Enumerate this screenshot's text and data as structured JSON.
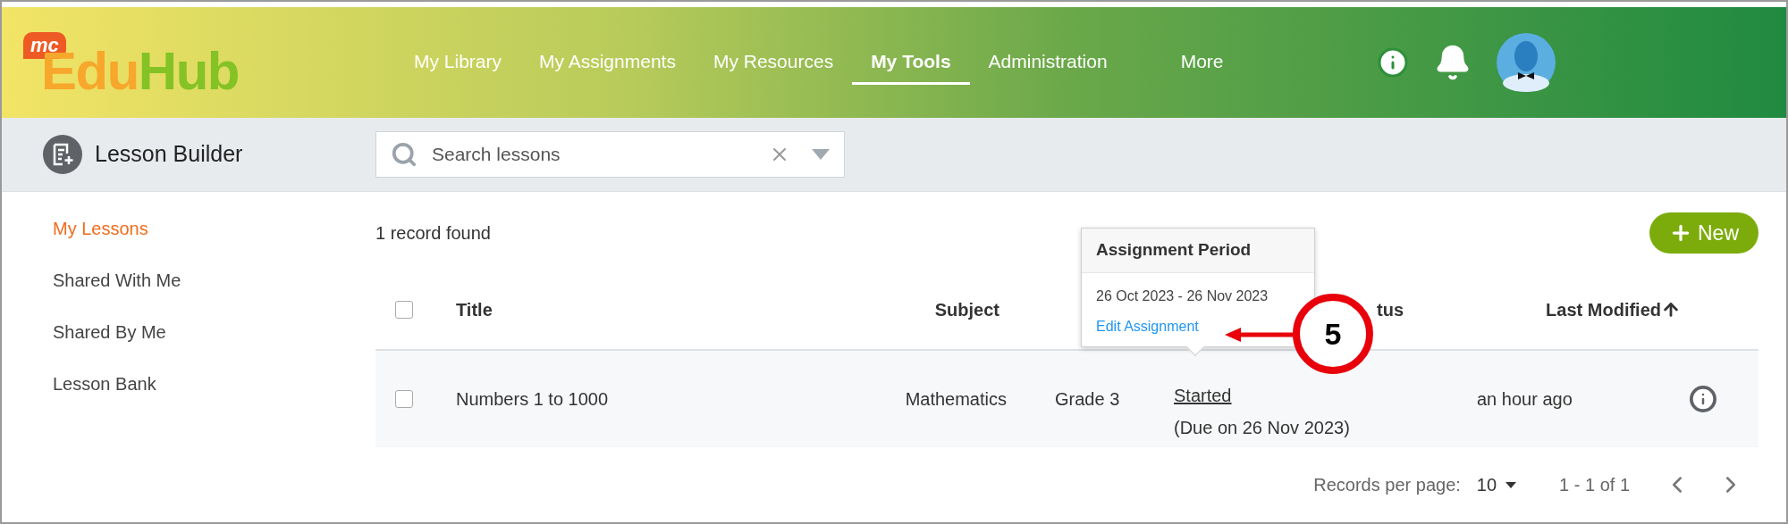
{
  "logo": {
    "badge": "mc",
    "part_1": "Edu",
    "part_2": "Hub"
  },
  "nav": [
    {
      "label": "My Library",
      "selected": false
    },
    {
      "label": "My Assignments",
      "selected": false
    },
    {
      "label": "My Resources",
      "selected": false
    },
    {
      "label": "My Tools",
      "selected": true
    },
    {
      "label": "Administration",
      "selected": false
    },
    {
      "label": "More",
      "selected": false
    }
  ],
  "toolbar": {
    "title": "Lesson Builder",
    "search": {
      "placeholder": "Search lessons"
    }
  },
  "sidebar": {
    "items": [
      {
        "label": "My Lessons",
        "selected": true
      },
      {
        "label": "Shared With Me",
        "selected": false
      },
      {
        "label": "Shared By Me",
        "selected": false
      },
      {
        "label": "Lesson Bank",
        "selected": false
      }
    ]
  },
  "record_count": "1 record found",
  "new_button": "New",
  "table": {
    "select_all": false,
    "columns": [
      "Title",
      "Subject",
      "tus",
      "Last Modified"
    ],
    "rows": [
      {
        "checked": false,
        "title": "Numbers 1 to 1000",
        "subject": "Mathematics",
        "grade": "Grade 3",
        "status": "Started",
        "due": "(Due on 26 Nov 2023)",
        "modified": "an hour ago"
      }
    ]
  },
  "popover": {
    "title": "Assignment Period",
    "period": "26 Oct 2023 - 26 Nov 2023",
    "link": "Edit Assignment"
  },
  "callout": "5",
  "pagination": {
    "label": "Records per page:",
    "per_page": "10",
    "range": "1 - 1 of 1"
  }
}
